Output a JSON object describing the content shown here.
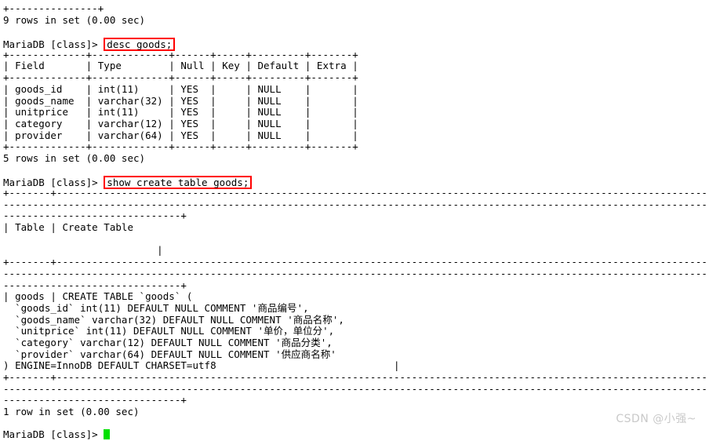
{
  "terminal": {
    "prompt": "MariaDB [class]> ",
    "lines_top": [
      "+---------------+",
      "9 rows in set (0.00 sec)"
    ],
    "command_1": "desc goods;",
    "desc_output": {
      "sep_line": "+-------------+-------------+------+-----+---------+-------+",
      "header_line": "| Field       | Type        | Null | Key | Default | Extra |",
      "rows": [
        "| goods_id    | int(11)     | YES  |     | NULL    |       |",
        "| goods_name  | varchar(32) | YES  |     | NULL    |       |",
        "| unitprice   | int(11)     | YES  |     | NULL    |       |",
        "| category    | varchar(12) | YES  |     | NULL    |       |",
        "| provider    | varchar(64) | YES  |     | NULL    |       |"
      ],
      "footer_status": "5 rows in set (0.00 sec)"
    },
    "command_2": "show create table goods;",
    "create_output": {
      "sep_wrap_1": "+-------+-------------------------------------------------------------------------------------------------------------------------",
      "sep_wrap_2": "--------------------------------------------------------------------------------------------------------------------------------",
      "sep_wrap_3": "------------------------------+",
      "header_line": "| Table | Create Table",
      "header_cont": "                          |",
      "body": [
        "| goods | CREATE TABLE `goods` (",
        "  `goods_id` int(11) DEFAULT NULL COMMENT '商品编号',",
        "  `goods_name` varchar(32) DEFAULT NULL COMMENT '商品名称',",
        "  `unitprice` int(11) DEFAULT NULL COMMENT '单价，单位分',",
        "  `category` varchar(12) DEFAULT NULL COMMENT '商品分类',",
        "  `provider` varchar(64) DEFAULT NULL COMMENT '供应商名称'",
        ") ENGINE=InnoDB DEFAULT CHARSET=utf8                              |"
      ],
      "footer_status": "1 row in set (0.00 sec)"
    }
  },
  "watermark": {
    "text": "CSDN @小强~"
  },
  "colors": {
    "background": "#ffffff",
    "text": "#000000",
    "highlight_box": "#ff0000",
    "cursor": "#00e000",
    "watermark": "#c9c9c9"
  }
}
